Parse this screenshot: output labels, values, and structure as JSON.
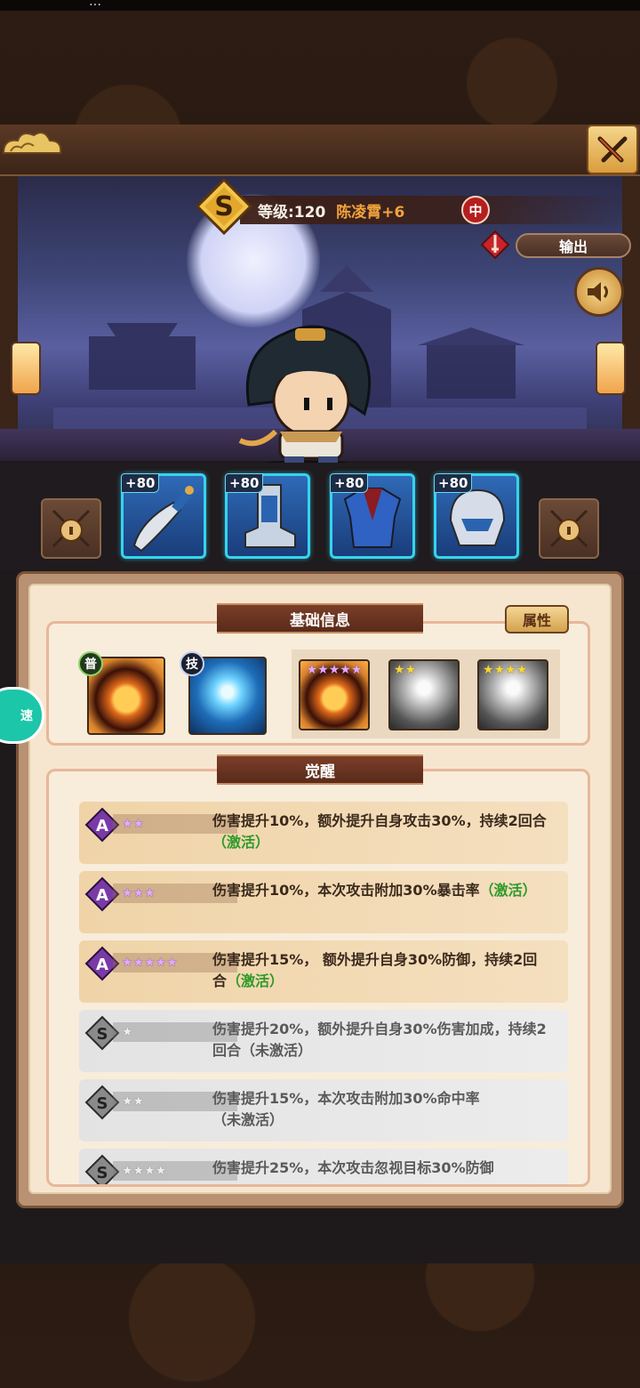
{
  "status_bar": {
    "text": "…"
  },
  "header": {
    "level_text": "等级:120",
    "hero_name": "陈凌霄+6",
    "position_badge": "中",
    "role_label": "输出",
    "close_icon": "close-swords-icon",
    "sound_icon": "speaker-icon"
  },
  "equipment": [
    {
      "plus": "+80",
      "icon": "saber-icon"
    },
    {
      "plus": "+80",
      "icon": "boot-icon"
    },
    {
      "plus": "+80",
      "icon": "armor-icon"
    },
    {
      "plus": "+80",
      "icon": "helmet-icon"
    }
  ],
  "info": {
    "basic_title": "基础信息",
    "attr_button": "属性",
    "skills": [
      {
        "tag": "普",
        "type": "fire"
      },
      {
        "tag": "技",
        "type": "ice"
      }
    ],
    "star_skills": [
      {
        "stars": 5,
        "type": "fire"
      },
      {
        "stars": 2,
        "type": "gray"
      },
      {
        "stars": 4,
        "type": "gray"
      }
    ],
    "awaken_title": "觉醒",
    "awaken": [
      {
        "grade": "A",
        "stars": 2,
        "active": true,
        "text": "伤害提升10%，额外提升自身攻击30%，持续2回合",
        "status": "（激活）"
      },
      {
        "grade": "A",
        "stars": 3,
        "active": true,
        "text": "伤害提升10%，本次攻击附加30%暴击率",
        "status": "（激活）"
      },
      {
        "grade": "A",
        "stars": 5,
        "active": true,
        "text": "伤害提升15%， 额外提升自身30%防御，持续2回合",
        "status": "（激活）"
      },
      {
        "grade": "S",
        "stars": 1,
        "active": false,
        "text": "伤害提升20%，额外提升自身30%伤害加成，持续2回合",
        "status": "（未激活）"
      },
      {
        "grade": "S",
        "stars": 2,
        "active": false,
        "text": "伤害提升15%，本次攻击附加30%命中率",
        "status": "（未激活）"
      },
      {
        "grade": "S",
        "stars": 4,
        "active": false,
        "text": "伤害提升25%，本次攻击忽视目标30%防御",
        "status": ""
      }
    ]
  },
  "side_bubble": {
    "text": "速"
  }
}
